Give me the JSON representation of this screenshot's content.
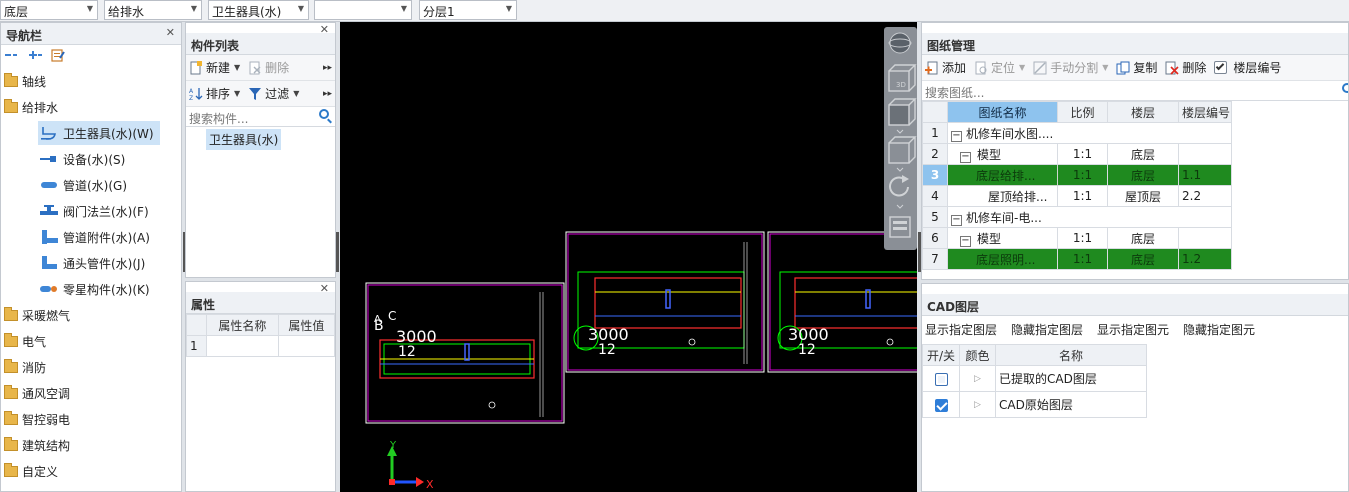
{
  "topbar": {
    "floor": "底层",
    "discipline": "给排水",
    "component": "卫生器具(水)",
    "blank": "",
    "sublayer": "分层1"
  },
  "nav": {
    "title": "导航栏",
    "categories": [
      {
        "label": "轴线"
      },
      {
        "label": "给排水"
      },
      {
        "label": "采暖燃气"
      },
      {
        "label": "电气"
      },
      {
        "label": "消防"
      },
      {
        "label": "通风空调"
      },
      {
        "label": "智控弱电"
      },
      {
        "label": "建筑结构"
      },
      {
        "label": "自定义"
      }
    ],
    "items": [
      {
        "label": "卫生器具(水)(W)"
      },
      {
        "label": "设备(水)(S)"
      },
      {
        "label": "管道(水)(G)"
      },
      {
        "label": "阀门法兰(水)(F)"
      },
      {
        "label": "管道附件(水)(A)"
      },
      {
        "label": "通头管件(水)(J)"
      },
      {
        "label": "零星构件(水)(K)"
      }
    ]
  },
  "complist": {
    "title": "构件列表",
    "new_label": "新建",
    "delete_label": "删除",
    "sort_label": "排序",
    "filter_label": "过滤",
    "search_placeholder": "搜索构件...",
    "selected_item": "卫生器具(水)"
  },
  "props": {
    "title": "属性",
    "col_name": "属性名称",
    "col_value": "属性值",
    "row1": "1"
  },
  "cad": {
    "axis_x": "X",
    "axis_y": "Y",
    "dim1": "3000",
    "dim2": "3000",
    "dim3": "3000",
    "num1": "12",
    "num2": "12",
    "num3": "12",
    "axA": "A",
    "axB": "B",
    "axC": "C"
  },
  "drawing": {
    "title": "图纸管理",
    "add": "添加",
    "locate": "定位",
    "manual_split": "手动分割",
    "copy": "复制",
    "delete": "删除",
    "floor_number": "楼层编号",
    "search_placeholder": "搜索图纸...",
    "headers": {
      "name": "图纸名称",
      "scale": "比例",
      "floor": "楼层",
      "floornum": "楼层编号"
    },
    "rows": [
      {
        "idx": "1",
        "name": "机修车间水图....",
        "scale": "",
        "floor": "",
        "num": "",
        "toggle": "−"
      },
      {
        "idx": "2",
        "name": "模型",
        "scale": "1:1",
        "floor": "底层",
        "num": "",
        "toggle": "−"
      },
      {
        "idx": "3",
        "name": "底层给排...",
        "scale": "1:1",
        "floor": "底层",
        "num": "1.1",
        "toggle": ""
      },
      {
        "idx": "4",
        "name": "屋顶给排...",
        "scale": "1:1",
        "floor": "屋顶层",
        "num": "2.2",
        "toggle": ""
      },
      {
        "idx": "5",
        "name": "机修车间-电...",
        "scale": "",
        "floor": "",
        "num": "",
        "toggle": "−"
      },
      {
        "idx": "6",
        "name": "模型",
        "scale": "1:1",
        "floor": "底层",
        "num": "",
        "toggle": "−"
      },
      {
        "idx": "7",
        "name": "底层照明...",
        "scale": "1:1",
        "floor": "底层",
        "num": "1.2",
        "toggle": ""
      }
    ]
  },
  "layers": {
    "title": "CAD图层",
    "show_layer": "显示指定图层",
    "hide_layer": "隐藏指定图层",
    "show_elem": "显示指定图元",
    "hide_elem": "隐藏指定图元",
    "col_onoff": "开/关",
    "col_color": "颜色",
    "col_name": "名称",
    "rows": [
      {
        "name": "已提取的CAD图层"
      },
      {
        "name": "CAD原始图层"
      }
    ]
  },
  "colors": {
    "highlight_green": "#1f8a1f",
    "accent_blue": "#2f7ed8"
  }
}
